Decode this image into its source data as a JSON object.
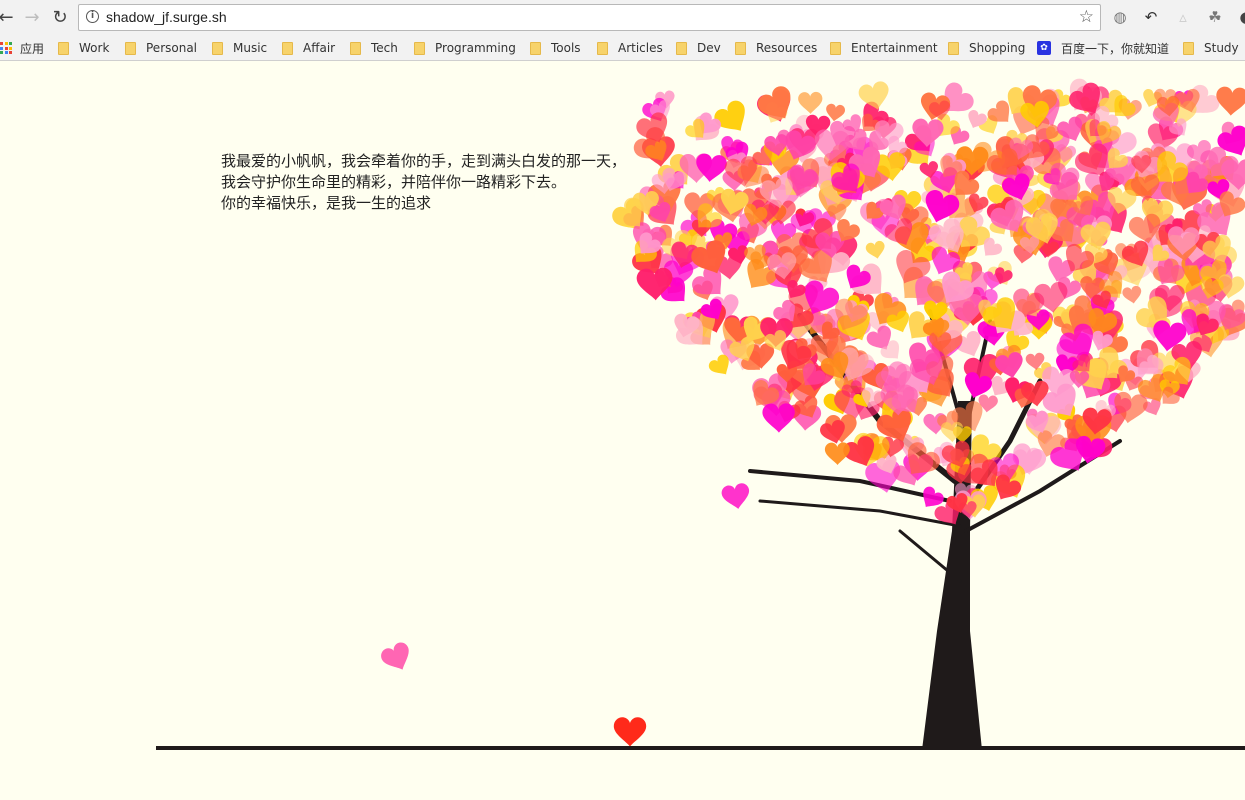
{
  "browser": {
    "url": "shadow_jf.surge.sh",
    "bookmarks": [
      {
        "label": "应用",
        "icon": "apps-grid-icon"
      },
      {
        "label": "Work",
        "icon": "folder-icon"
      },
      {
        "label": "Personal",
        "icon": "folder-icon"
      },
      {
        "label": "Music",
        "icon": "folder-icon"
      },
      {
        "label": "Affair",
        "icon": "folder-icon"
      },
      {
        "label": "Tech",
        "icon": "folder-icon"
      },
      {
        "label": "Programming",
        "icon": "folder-icon"
      },
      {
        "label": "Tools",
        "icon": "folder-icon"
      },
      {
        "label": "Articles",
        "icon": "folder-icon"
      },
      {
        "label": "Dev",
        "icon": "folder-icon"
      },
      {
        "label": "Resources",
        "icon": "folder-icon"
      },
      {
        "label": "Entertainment",
        "icon": "folder-icon"
      },
      {
        "label": "Shopping",
        "icon": "folder-icon"
      },
      {
        "label": "百度一下，你就知道",
        "icon": "baidu-paw-icon"
      },
      {
        "label": "Study",
        "icon": "folder-icon"
      }
    ]
  },
  "page": {
    "poem": [
      "我最爱的小帆帆，我会牵着你的手，走到满头白发的那一天，",
      "我会守护你生命里的精彩，并陪伴你一路精彩下去。",
      "你的幸福快乐，是我一生的追求"
    ],
    "background_color": "#fffff0",
    "heart_colors": [
      "#ff1f6b",
      "#ff66b3",
      "#ff99cc",
      "#ff3344",
      "#ff8c1a",
      "#ffcc00",
      "#ff00cc",
      "#ff5f3c",
      "#ffb3c6",
      "#ff7744",
      "#ffd24d",
      "#ff44aa"
    ],
    "trunk_color": "#1f1a1a"
  }
}
